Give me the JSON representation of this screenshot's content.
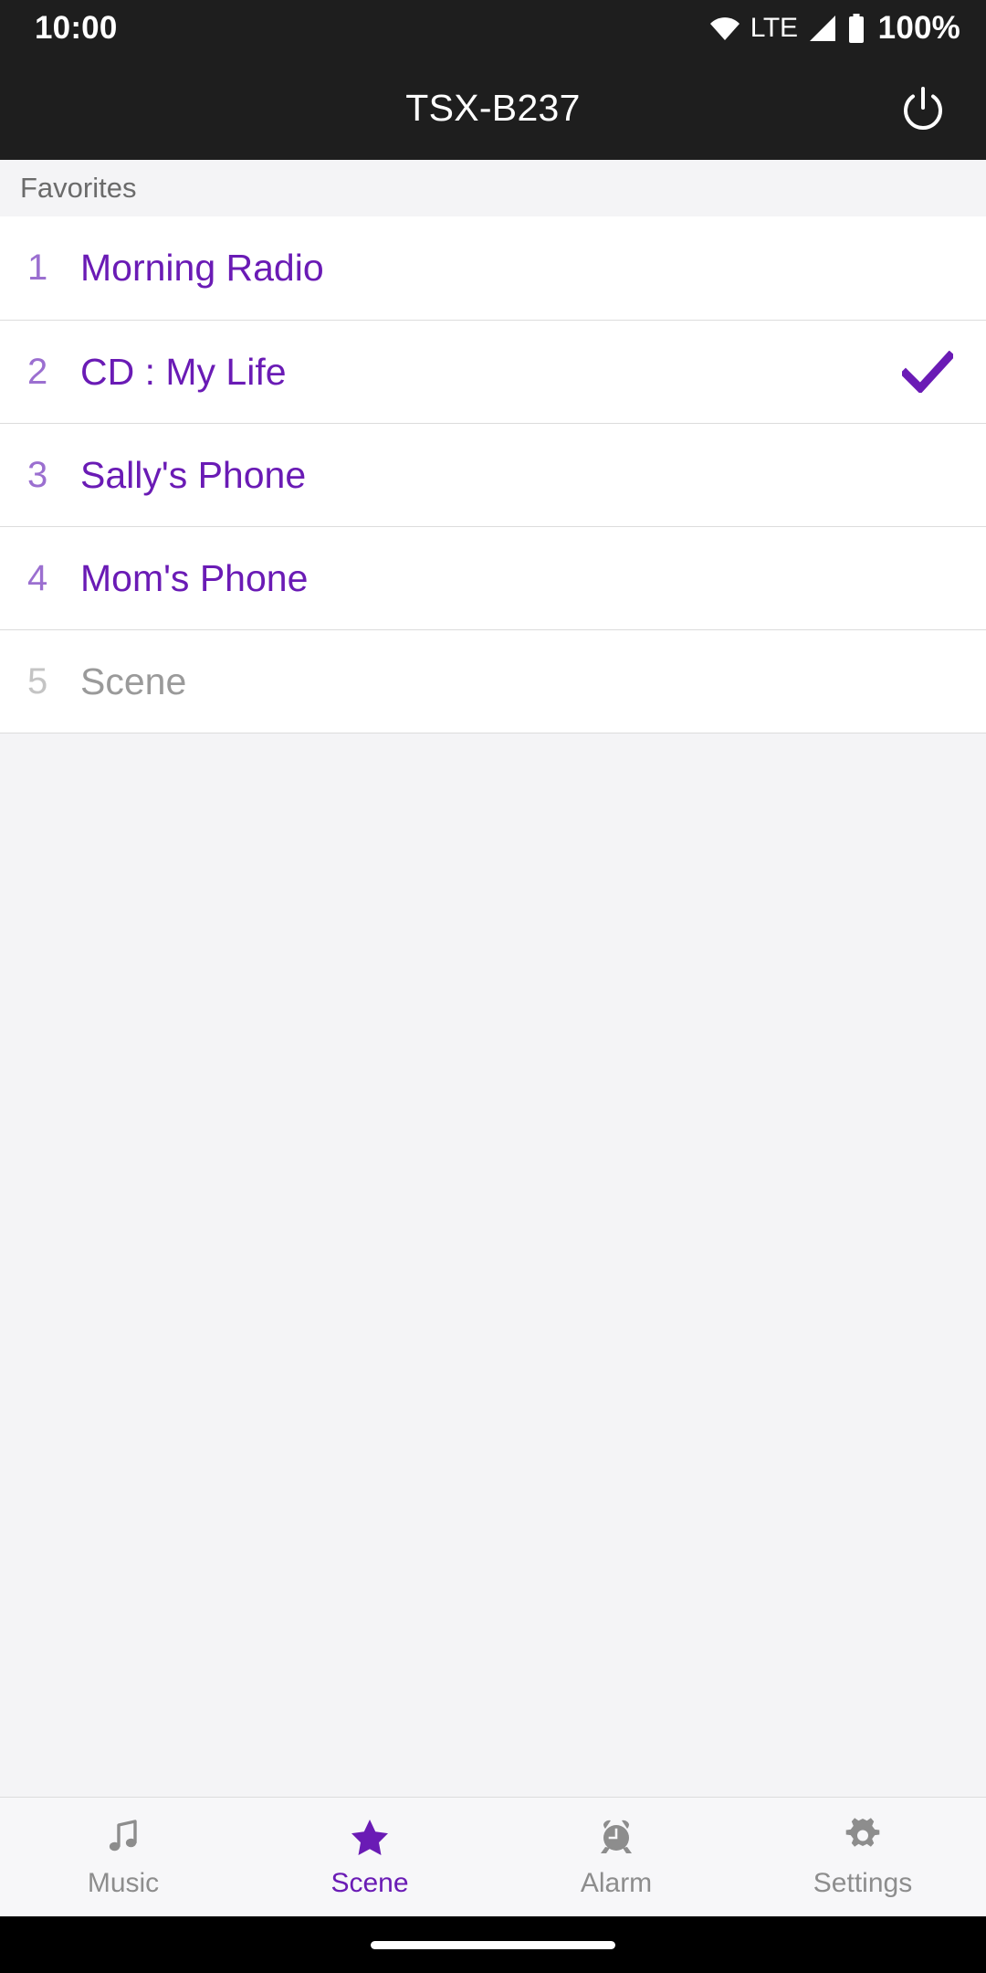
{
  "status_bar": {
    "clock": "10:00",
    "network_label": "LTE",
    "battery_percent": "100%",
    "icons": [
      "wifi-icon",
      "cellular-signal-icon",
      "battery-icon"
    ]
  },
  "app_bar": {
    "title": "TSX-B237",
    "power_icon": "power-icon"
  },
  "section": {
    "header": "Favorites"
  },
  "favorites": [
    {
      "index": "1",
      "label": "Morning Radio",
      "selected": false,
      "enabled": true
    },
    {
      "index": "2",
      "label": "CD : My Life",
      "selected": true,
      "enabled": true
    },
    {
      "index": "3",
      "label": "Sally's Phone",
      "selected": false,
      "enabled": true
    },
    {
      "index": "4",
      "label": "Mom's Phone",
      "selected": false,
      "enabled": true
    },
    {
      "index": "5",
      "label": "Scene",
      "selected": false,
      "enabled": false
    }
  ],
  "tabs": [
    {
      "label": "Music",
      "icon": "music-note-icon",
      "active": false
    },
    {
      "label": "Scene",
      "icon": "star-icon",
      "active": true
    },
    {
      "label": "Alarm",
      "icon": "alarm-clock-icon",
      "active": false
    },
    {
      "label": "Settings",
      "icon": "gear-icon",
      "active": false
    }
  ],
  "colors": {
    "accent": "#6A1BB5",
    "accent_light": "#9B6FD0",
    "header_bg": "#1E1E1E",
    "page_bg": "#F4F4F6",
    "list_bg": "#FFFFFF",
    "divider": "#DCDCDC",
    "muted_text": "#8D8D8D",
    "disabled_text": "#9A9A9A"
  }
}
